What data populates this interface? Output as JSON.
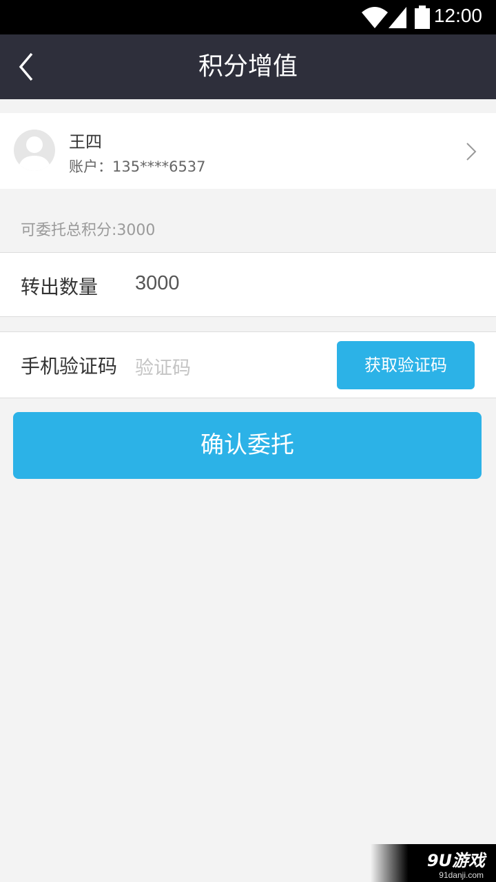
{
  "status_bar": {
    "time": "12:00"
  },
  "nav": {
    "title": "积分增值"
  },
  "profile": {
    "name": "王四",
    "account": "账户：135****6537"
  },
  "total_points_label": "可委托总积分:3000",
  "transfer": {
    "label": "转出数量",
    "value": "3000"
  },
  "verification": {
    "label": "手机验证码",
    "placeholder": "验证码",
    "get_code_button": "获取验证码"
  },
  "confirm_button": "确认委托",
  "watermark": {
    "logo": "9U游戏",
    "url": "91danji.com"
  },
  "colors": {
    "accent": "#2cb2e7",
    "nav_bg": "#2e2f3b",
    "page_bg": "#f3f3f3"
  }
}
